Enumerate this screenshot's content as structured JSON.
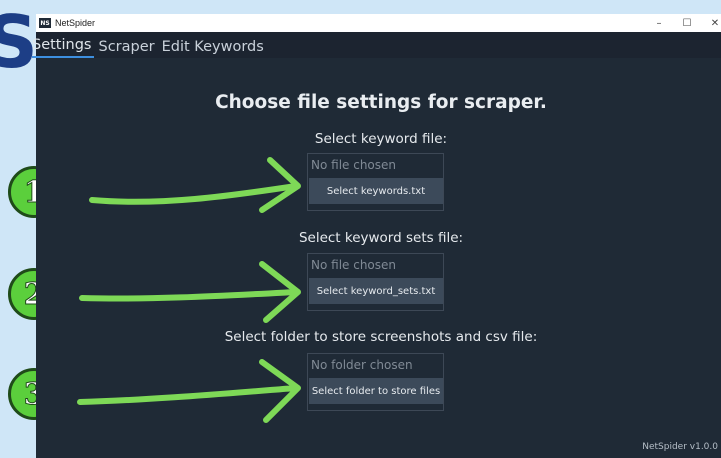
{
  "overlay": {
    "big_letter": "S",
    "steps": [
      "1",
      "2",
      "3"
    ],
    "arrow_color": "#7ed957"
  },
  "window": {
    "title": "NetSpider",
    "icon_text": "NS",
    "controls": {
      "minimize": "–",
      "maximize": "☐",
      "close": "✕"
    }
  },
  "tabs": [
    {
      "label": "Settings",
      "active": true
    },
    {
      "label": "Scraper",
      "active": false
    },
    {
      "label": "Edit Keywords",
      "active": false
    }
  ],
  "main": {
    "title": "Choose file settings for scraper.",
    "sections": [
      {
        "label": "Select keyword file:",
        "status": "No file chosen",
        "button": "Select keywords.txt"
      },
      {
        "label": "Select keyword sets file:",
        "status": "No file chosen",
        "button": "Select keyword_sets.txt"
      },
      {
        "label": "Select folder to store screenshots and csv file:",
        "status": "No folder chosen",
        "button": "Select folder to store files"
      }
    ]
  },
  "footer": {
    "version": "NetSpider v1.0.0"
  },
  "colors": {
    "background": "#cfe6f7",
    "window_bg": "#1f2a36",
    "button_bg": "#3c4a5a",
    "tab_active_underline": "#3d8fe0",
    "badge_green": "#5bcf3c"
  }
}
